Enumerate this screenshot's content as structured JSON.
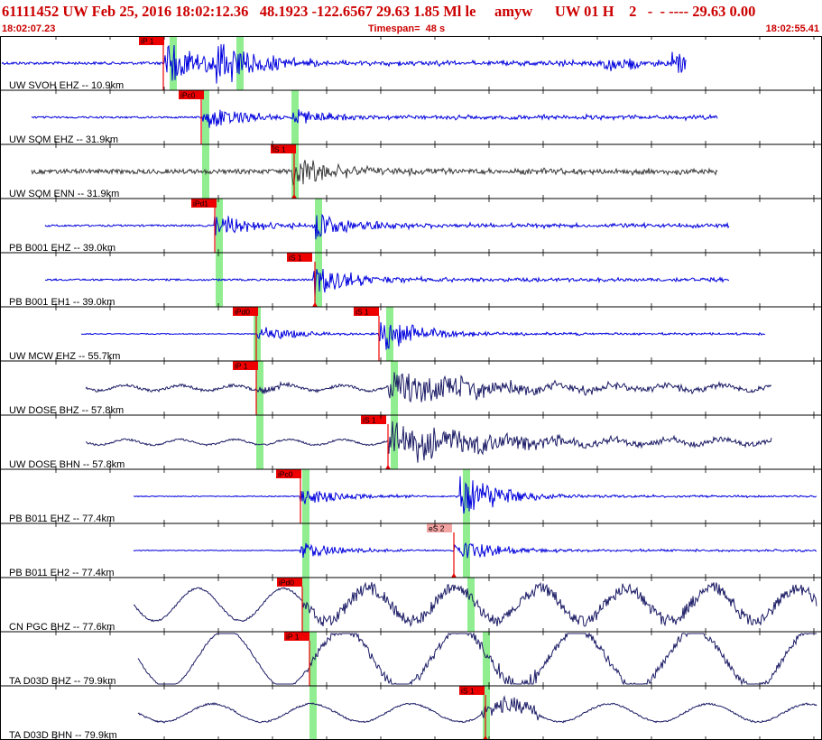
{
  "header": {
    "title": "61111452 UW Feb 25, 2016 18:02:12.36   48.1923 -122.6567 29.63 1.85 Ml le     amyw      UW 01 H    2   -  - ---- 29.63 0.00",
    "start_time": "18:02:07.23",
    "timespan": "Timespan=  48 s",
    "end_time": "18:02:55.41"
  },
  "colors": {
    "header_text": "#cc0000",
    "grid_line": "#000000",
    "pick_box": "#ee0000",
    "pick_box_light": "#f4a3a3",
    "theoretical_marker": "#90ee90",
    "trace_blue": "#0000dd",
    "trace_gray": "#3a3a3a",
    "trace_navy": "#1c1c66"
  },
  "channels": [
    {
      "label": "UW SVOH EHZ -- 10.9km",
      "color": "trace_blue",
      "p_pick": "iP 1",
      "s_pick": ""
    },
    {
      "label": "UW SQM EHZ -- 31.9km",
      "color": "trace_blue",
      "p_pick": "iPc0",
      "s_pick": ""
    },
    {
      "label": "UW SQM ENN -- 31.9km",
      "color": "trace_gray",
      "p_pick": "",
      "s_pick": "iS 1"
    },
    {
      "label": "PB B001 EHZ -- 39.0km",
      "color": "trace_blue",
      "p_pick": "iPd1",
      "s_pick": ""
    },
    {
      "label": "PB B001 EH1 -- 39.0km",
      "color": "trace_blue",
      "p_pick": "",
      "s_pick": "iS 1"
    },
    {
      "label": "UW MCW EHZ -- 55.7km",
      "color": "trace_blue",
      "p_pick": "iPd0",
      "s_pick": "iS 1"
    },
    {
      "label": "UW DOSE BHZ -- 57.8km",
      "color": "trace_navy",
      "p_pick": "iP 1",
      "s_pick": ""
    },
    {
      "label": "UW DOSE BHN -- 57.8km",
      "color": "trace_navy",
      "p_pick": "",
      "s_pick": "iS 1"
    },
    {
      "label": "PB B011 EHZ -- 77.4km",
      "color": "trace_blue",
      "p_pick": "iPc0",
      "s_pick": ""
    },
    {
      "label": "PB B011 EH2 -- 77.4km",
      "color": "trace_blue",
      "p_pick": "",
      "s_pick": "eS 2"
    },
    {
      "label": "CN PGC BHZ -- 77.6km",
      "color": "trace_navy",
      "p_pick": "iPd0",
      "s_pick": ""
    },
    {
      "label": "TA D03D BHZ -- 79.9km",
      "color": "trace_navy",
      "p_pick": "iP 1",
      "s_pick": ""
    },
    {
      "label": "TA D03D BHN -- 79.9km",
      "color": "trace_navy",
      "p_pick": "",
      "s_pick": "iS 1"
    }
  ]
}
